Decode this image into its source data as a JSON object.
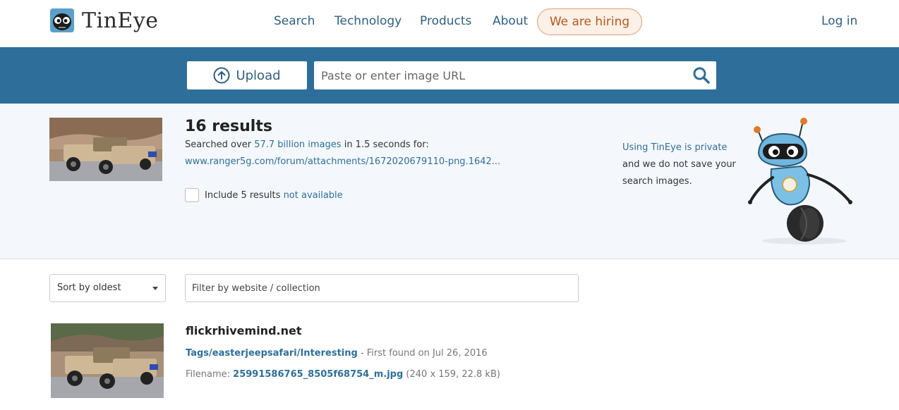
{
  "brand": {
    "name": "TinEye"
  },
  "nav": {
    "items": [
      {
        "label": "Search"
      },
      {
        "label": "Technology"
      },
      {
        "label": "Products"
      },
      {
        "label": "About"
      }
    ],
    "hiring_label": "We are hiring",
    "login_label": "Log in"
  },
  "search": {
    "upload_label": "Upload",
    "url_placeholder": "Paste or enter image URL"
  },
  "summary": {
    "results_title": "16 results",
    "searched_prefix": "Searched over",
    "searched_count": "57.7 billion images",
    "searched_suffix": "in 1.5 seconds for:",
    "query_url": "www.ranger5g.com/forum/attachments/1672020679110-png.1642...",
    "include_prefix": "Include 5 results",
    "include_link": "not available",
    "private_link": "Using TinEye is private",
    "private_text": "and we do not save your search images."
  },
  "filters": {
    "sort_value": "Sort by oldest",
    "filter_placeholder": "Filter by website / collection"
  },
  "results": [
    {
      "site": "flickrhivemind.net",
      "path": "Tags/easterjeepsafari/Interesting",
      "first_found": "- First found on Jul 26, 2016",
      "filename_label": "Filename:",
      "filename": "25991586765_8505f68754_m.jpg",
      "file_meta": "(240 x 159, 22.8 kB)"
    }
  ],
  "colors": {
    "band": "#2e6e9a",
    "link": "#2f6f99",
    "hiring_bg": "#fdf0e6",
    "hiring_text": "#b35a1f"
  }
}
